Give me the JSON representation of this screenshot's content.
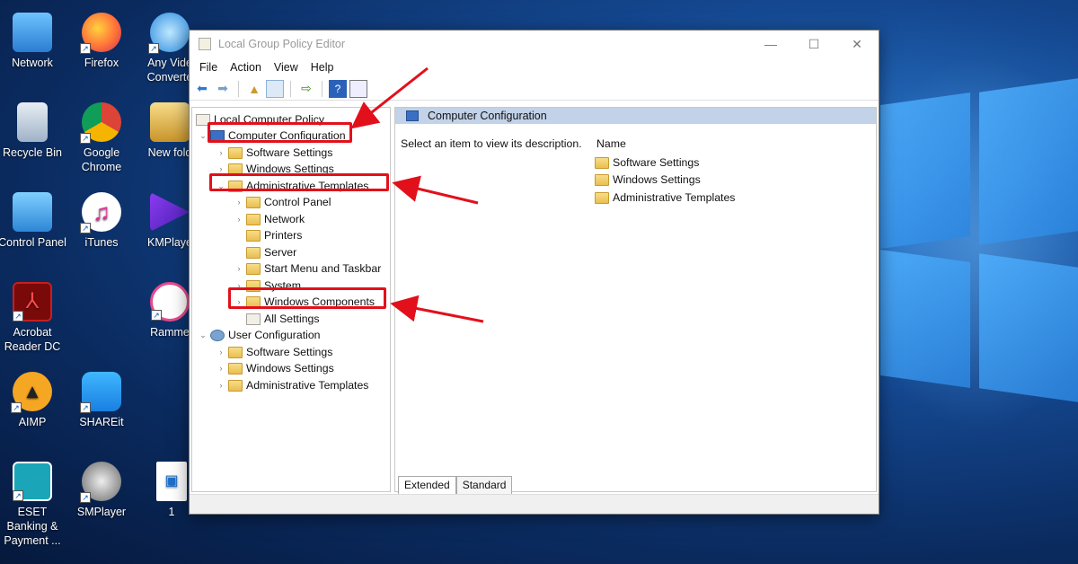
{
  "desktop": {
    "icons": [
      {
        "label": "Network",
        "icon": "network-icon"
      },
      {
        "label": "Firefox",
        "icon": "firefox-icon"
      },
      {
        "label": "Any Vide Converte",
        "icon": "any-video-converter-icon"
      },
      {
        "label": "Recycle Bin",
        "icon": "recycle-bin-icon"
      },
      {
        "label": "Google Chrome",
        "icon": "chrome-icon"
      },
      {
        "label": "New fold",
        "icon": "folder-icon"
      },
      {
        "label": "Control Panel",
        "icon": "control-panel-icon"
      },
      {
        "label": "iTunes",
        "icon": "itunes-icon"
      },
      {
        "label": "KMPlaye",
        "icon": "kmplayer-icon"
      },
      {
        "label": "Acrobat Reader DC",
        "icon": "acrobat-icon"
      },
      {
        "label": "Ramme",
        "icon": "photos-icon"
      },
      {
        "label": "AIMP",
        "icon": "aimp-icon"
      },
      {
        "label": "SHAREit",
        "icon": "shareit-icon"
      },
      {
        "label": "ESET Banking & Payment ...",
        "icon": "eset-icon"
      },
      {
        "label": "SMPlayer",
        "icon": "smplayer-icon"
      },
      {
        "label": "1",
        "icon": "video-file-icon"
      }
    ]
  },
  "window": {
    "title": "Local Group Policy Editor",
    "controls": {
      "minimize": "—",
      "maximize": "☐",
      "close": "✕"
    },
    "menu": [
      "File",
      "Action",
      "View",
      "Help"
    ],
    "tree": {
      "root": "Local Computer Policy",
      "items": [
        {
          "label": "Computer Configuration",
          "arrow": "⌄",
          "icon": "computer-icon"
        },
        {
          "label": "Software Settings",
          "arrow": "›",
          "icon": "folder-icon"
        },
        {
          "label": "Windows Settings",
          "arrow": "›",
          "icon": "folder-icon"
        },
        {
          "label": "Administrative Templates",
          "arrow": "⌄",
          "icon": "folder-icon"
        },
        {
          "label": "Control Panel",
          "arrow": "›",
          "icon": "folder-icon"
        },
        {
          "label": "Network",
          "arrow": "›",
          "icon": "folder-icon"
        },
        {
          "label": "Printers",
          "arrow": "",
          "icon": "folder-icon"
        },
        {
          "label": "Server",
          "arrow": "",
          "icon": "folder-icon"
        },
        {
          "label": "Start Menu and Taskbar",
          "arrow": "›",
          "icon": "folder-icon"
        },
        {
          "label": "System",
          "arrow": "›",
          "icon": "folder-icon"
        },
        {
          "label": "Windows Components",
          "arrow": "›",
          "icon": "folder-icon"
        },
        {
          "label": "All Settings",
          "arrow": "",
          "icon": "settings-list-icon"
        },
        {
          "label": "User Configuration",
          "arrow": "⌄",
          "icon": "user-icon"
        },
        {
          "label": "Software Settings",
          "arrow": "›",
          "icon": "folder-icon"
        },
        {
          "label": "Windows Settings",
          "arrow": "›",
          "icon": "folder-icon"
        },
        {
          "label": "Administrative Templates",
          "arrow": "›",
          "icon": "folder-icon"
        }
      ]
    },
    "right_pane": {
      "header": "Computer Configuration",
      "description": "Select an item to view its description.",
      "column_name": "Name",
      "items": [
        "Software Settings",
        "Windows Settings",
        "Administrative Templates"
      ]
    },
    "tabs": [
      "Extended",
      "Standard"
    ]
  },
  "annotation_color": "#e2101b"
}
